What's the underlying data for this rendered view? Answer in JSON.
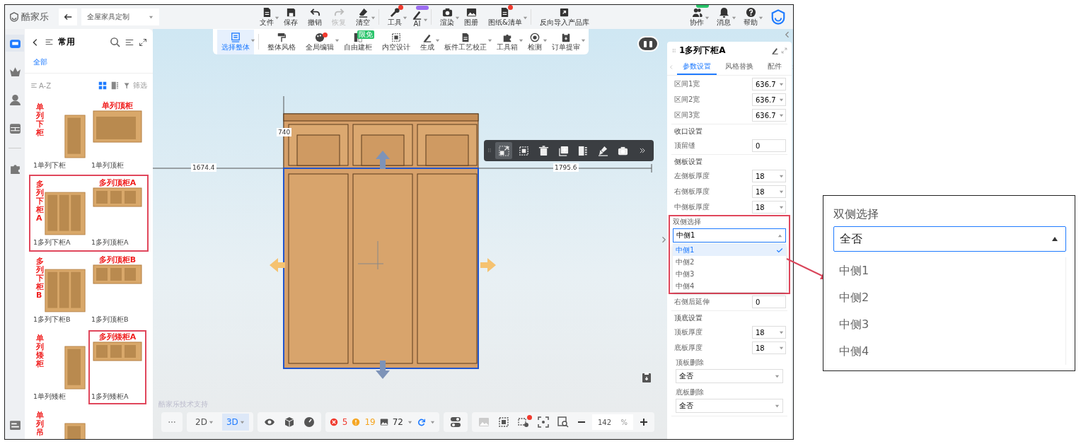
{
  "app": {
    "logo": "酷家乐",
    "project": "全屋家具定制"
  },
  "top_toolbar": [
    {
      "label": "文件",
      "dropdown": true,
      "disabled": false,
      "dot": false
    },
    {
      "label": "保存",
      "dropdown": false,
      "disabled": false,
      "dot": false
    },
    {
      "label": "撤销",
      "dropdown": false,
      "disabled": false,
      "dot": false
    },
    {
      "label": "恢复",
      "dropdown": false,
      "disabled": true,
      "dot": false
    },
    {
      "label": "清空",
      "dropdown": true,
      "disabled": false,
      "dot": false
    },
    {
      "label": "工具",
      "dropdown": true,
      "disabled": false,
      "dot": true
    },
    {
      "label": "AI",
      "dropdown": true,
      "disabled": false,
      "dot": false,
      "badge": true
    },
    {
      "label": "渲染",
      "dropdown": true,
      "disabled": false,
      "dot": false
    },
    {
      "label": "图册",
      "dropdown": false,
      "disabled": false,
      "dot": false
    },
    {
      "label": "图纸&清单",
      "dropdown": true,
      "disabled": false,
      "dot": true
    },
    {
      "label": "反向导入产品库",
      "dropdown": false,
      "disabled": false,
      "dot": false
    }
  ],
  "user_tools": [
    {
      "label": "协作",
      "badge": true
    },
    {
      "label": "消息",
      "badge": false
    },
    {
      "label": "帮助",
      "badge": false
    }
  ],
  "main_toolbar": [
    {
      "label": "选择整体",
      "selected": true,
      "dropdown": true,
      "dot": false
    },
    {
      "label": "整体风格",
      "selected": false,
      "dropdown": false,
      "dot": false
    },
    {
      "label": "全局编辑",
      "selected": false,
      "dropdown": true,
      "dot": true
    },
    {
      "label": "自由建柜",
      "selected": false,
      "dropdown": false,
      "dot": false,
      "badge": "限免"
    },
    {
      "label": "内空设计",
      "selected": false,
      "dropdown": false,
      "dot": false
    },
    {
      "label": "生成",
      "selected": false,
      "dropdown": true,
      "dot": false
    },
    {
      "label": "板件工艺校正",
      "selected": false,
      "dropdown": true,
      "dot": false
    },
    {
      "label": "工具箱",
      "selected": false,
      "dropdown": true,
      "dot": false
    },
    {
      "label": "检测",
      "selected": false,
      "dropdown": true,
      "dot": false
    },
    {
      "label": "订单提审",
      "selected": false,
      "dropdown": true,
      "dot": false
    }
  ],
  "left_rail": [
    {
      "selected": true
    },
    {
      "selected": false
    },
    {
      "selected": false
    },
    {
      "selected": false
    },
    {
      "selected": false
    },
    {
      "selected": false
    }
  ],
  "left_panel": {
    "title": "常用",
    "category": "全部",
    "sort": "A-Z",
    "filter": "筛选",
    "grid_view": true,
    "rows": [
      {
        "framed": false,
        "items": [
          {
            "label": "1单列下柜",
            "annotation": "单列下柜",
            "vertical": true,
            "framed": false
          },
          {
            "label": "1单列顶柜",
            "annotation": "单列顶柜",
            "vertical": false,
            "framed": false
          }
        ]
      },
      {
        "framed": true,
        "items": [
          {
            "label": "1多列下柜A",
            "annotation": "多列下柜A",
            "vertical": true,
            "framed": false
          },
          {
            "label": "1多列顶柜A",
            "annotation": "多列顶柜A",
            "vertical": false,
            "framed": false
          }
        ]
      },
      {
        "framed": false,
        "items": [
          {
            "label": "1多列下柜B",
            "annotation": "多列下柜B",
            "vertical": true,
            "framed": false
          },
          {
            "label": "1多列顶柜B",
            "annotation": "多列顶柜B",
            "vertical": false,
            "framed": false
          }
        ]
      },
      {
        "framed": false,
        "items": [
          {
            "label": "1单列矮柜",
            "annotation": "单列矮柜",
            "vertical": true,
            "framed": false
          },
          {
            "label": "1多列矮柜A",
            "annotation": "多列矮柜A",
            "vertical": false,
            "framed": true
          }
        ]
      },
      {
        "framed": false,
        "items": [
          {
            "annotation": "单列吊",
            "vertical": true,
            "framed": false
          }
        ]
      }
    ]
  },
  "canvas": {
    "height_label": "740",
    "left_label": "1674.4",
    "right_label": "1795.6",
    "credit": "酷家乐技术支持",
    "floating_toolbar": [
      {
        "selected": true
      },
      {
        "selected": false
      },
      {
        "selected": false
      },
      {
        "selected": false
      },
      {
        "selected": false
      },
      {
        "selected": false
      },
      {
        "selected": false
      }
    ]
  },
  "properties": {
    "title": "1多列下柜A",
    "tabs": [
      {
        "label": "参数设置",
        "selected": true
      },
      {
        "label": "风格替换",
        "selected": false
      },
      {
        "label": "配件",
        "selected": false
      }
    ],
    "sections": [
      {
        "fields": [
          {
            "kind": "select",
            "label": "区间1宽",
            "value": "636.7"
          },
          {
            "kind": "select",
            "label": "区间2宽",
            "value": "636.7"
          },
          {
            "kind": "select",
            "label": "区间3宽",
            "value": "636.7"
          }
        ]
      },
      {
        "title": "收口设置",
        "fields": [
          {
            "kind": "input",
            "label": "顶留缝",
            "value": "0"
          }
        ]
      },
      {
        "title": "侧板设置",
        "fields": [
          {
            "kind": "select",
            "label": "左侧板厚度",
            "value": "18"
          },
          {
            "kind": "select",
            "label": "右侧板厚度",
            "value": "18"
          },
          {
            "kind": "select",
            "label": "中侧板厚度",
            "value": "18"
          },
          {
            "kind": "stacked_select",
            "label": "双侧选择",
            "value": "中侧1",
            "open": true,
            "framed": true,
            "options": [
              {
                "label": "中侧1",
                "selected": true
              },
              {
                "label": "中侧2",
                "selected": false
              },
              {
                "label": "中侧3",
                "selected": false
              },
              {
                "label": "中侧4",
                "selected": false
              }
            ]
          },
          {
            "kind": "input",
            "label": "右侧后延伸",
            "value": "0"
          }
        ]
      },
      {
        "title": "顶底设置",
        "fields": [
          {
            "kind": "select",
            "label": "顶板厚度",
            "value": "18"
          },
          {
            "kind": "select",
            "label": "底板厚度",
            "value": "18"
          },
          {
            "kind": "stacked_select",
            "label": "顶板删除",
            "value": "全否",
            "open": false,
            "framed": false
          },
          {
            "kind": "stacked_select",
            "label": "底板删除",
            "value": "全否",
            "open": false,
            "framed": false
          }
        ]
      }
    ]
  },
  "bottom_bar": {
    "view_modes": [
      {
        "label": "2D",
        "selected": false
      },
      {
        "label": "3D",
        "selected": true
      }
    ],
    "errors": "5",
    "warnings": "19",
    "count": "72",
    "zoom": "142",
    "zoom_unit": "%",
    "view_tools": [
      {
        "disabled": true,
        "dot": false
      },
      {
        "disabled": false,
        "dot": false
      },
      {
        "disabled": false,
        "dot": true
      },
      {
        "disabled": false,
        "dot": false
      },
      {
        "disabled": false,
        "dot": false
      }
    ]
  },
  "callout": {
    "label": "双侧选择",
    "value": "全否",
    "options": [
      {
        "label": "中侧1"
      },
      {
        "label": "中侧2"
      },
      {
        "label": "中侧3"
      },
      {
        "label": "中侧4"
      }
    ]
  }
}
